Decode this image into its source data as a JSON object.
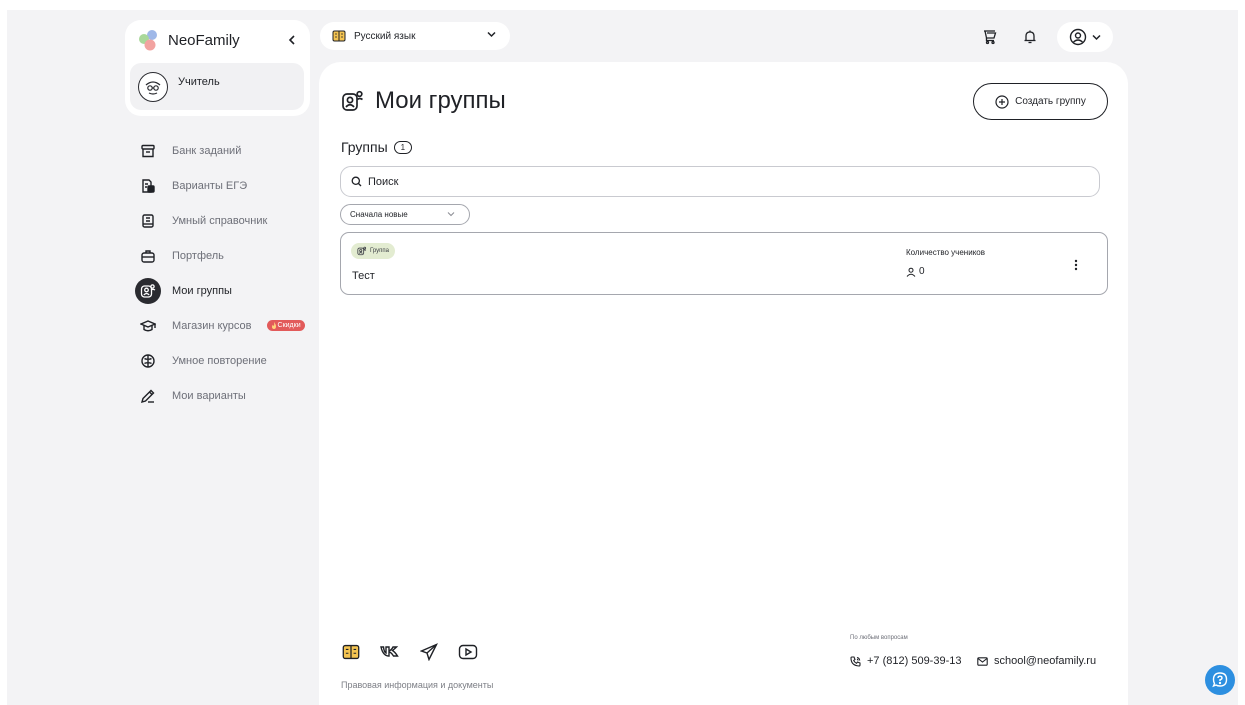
{
  "brand": {
    "name": "NeoFamily"
  },
  "role": {
    "label": "Учитель"
  },
  "sidebar": {
    "items": [
      {
        "label": "Банк заданий",
        "icon": "archive-icon"
      },
      {
        "label": "Варианты ЕГЭ",
        "icon": "documents-icon"
      },
      {
        "label": "Умный справочник",
        "icon": "book-icon"
      },
      {
        "label": "Портфель",
        "icon": "briefcase-icon"
      },
      {
        "label": "Мои группы",
        "icon": "group-icon",
        "active": true
      },
      {
        "label": "Магазин курсов",
        "icon": "graduation-cap-icon",
        "badge": "Скидки"
      },
      {
        "label": "Умное повторение",
        "icon": "brain-icon"
      },
      {
        "label": "Мои варианты",
        "icon": "pencil-icon"
      }
    ]
  },
  "topbar": {
    "subject": "Русский язык"
  },
  "main": {
    "title": "Мои группы",
    "create_button": "Создать группу",
    "groups_label": "Группы",
    "groups_count": "1",
    "search_placeholder": "Поиск",
    "sort_label": "Сначала новые",
    "groups": [
      {
        "tag": "Группа",
        "name": "Тест",
        "students_label": "Количество учеников",
        "students_count": "0"
      }
    ]
  },
  "footer": {
    "legal": "Правовая информация и документы",
    "contact_caption": "По любым вопросам",
    "phone": "+7 (812) 509-39-13",
    "email": "school@neofamily.ru"
  },
  "colors": {
    "accent": "#2d8fe0",
    "tag_bg": "#e3ecd1",
    "badge": "#e25a5a",
    "background": "#f3f3f5"
  }
}
